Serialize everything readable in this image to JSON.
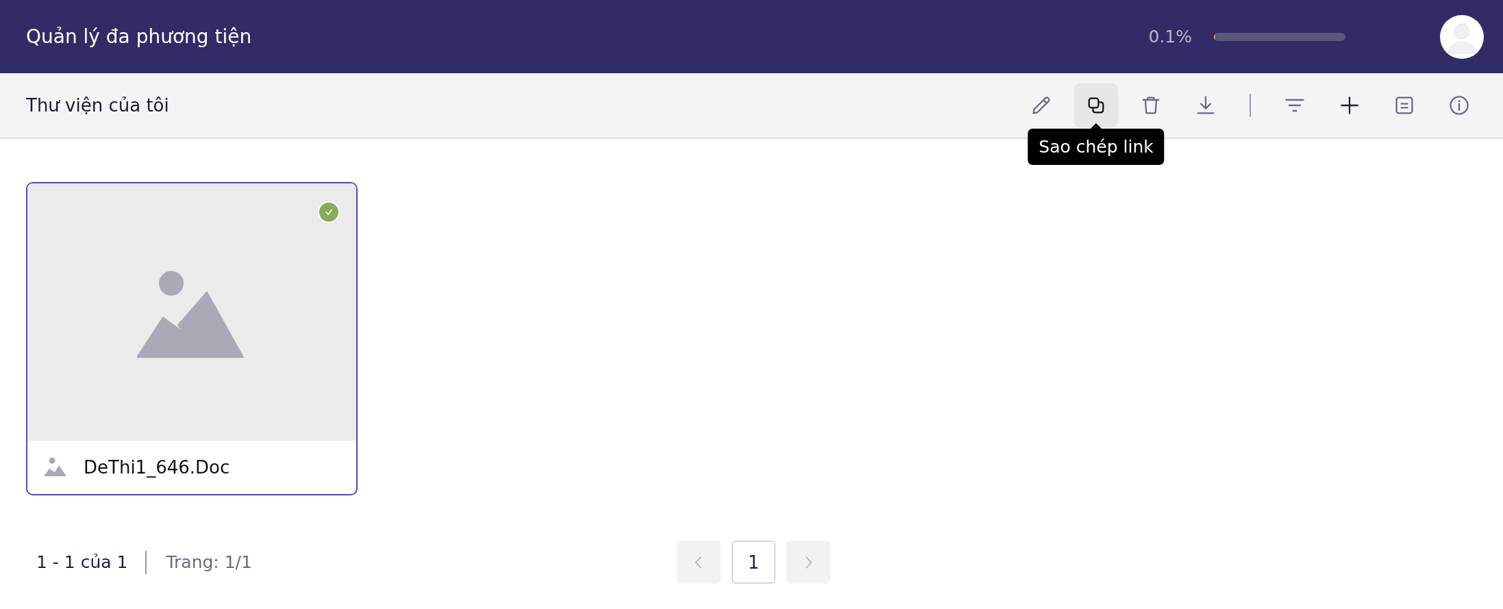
{
  "header": {
    "title": "Quản lý đa phương tiện",
    "storage": {
      "reading": "0.1%",
      "level": 0.001
    }
  },
  "toolbar": {
    "title": "Thư viện của tôi",
    "items": [
      {
        "kind": "button",
        "hovered": false
      },
      {
        "kind": "button",
        "hovered": true,
        "tooltip": "Sao chép link"
      },
      {
        "kind": "button",
        "hovered": false
      },
      {
        "kind": "button",
        "hovered": false
      },
      {
        "kind": "separator"
      },
      {
        "kind": "button",
        "hovered": false
      },
      {
        "kind": "button",
        "hovered": false
      },
      {
        "kind": "button",
        "hovered": false
      },
      {
        "kind": "button",
        "hovered": false
      }
    ]
  },
  "files": [
    {
      "name": "DeThi1_646.Doc",
      "selected": true
    }
  ],
  "pagination": {
    "range": "1 - 1 của 1",
    "page_info": "Trang: 1/1",
    "prev": {
      "disabled": true
    },
    "current_page": "1",
    "next": {
      "disabled": true
    }
  }
}
